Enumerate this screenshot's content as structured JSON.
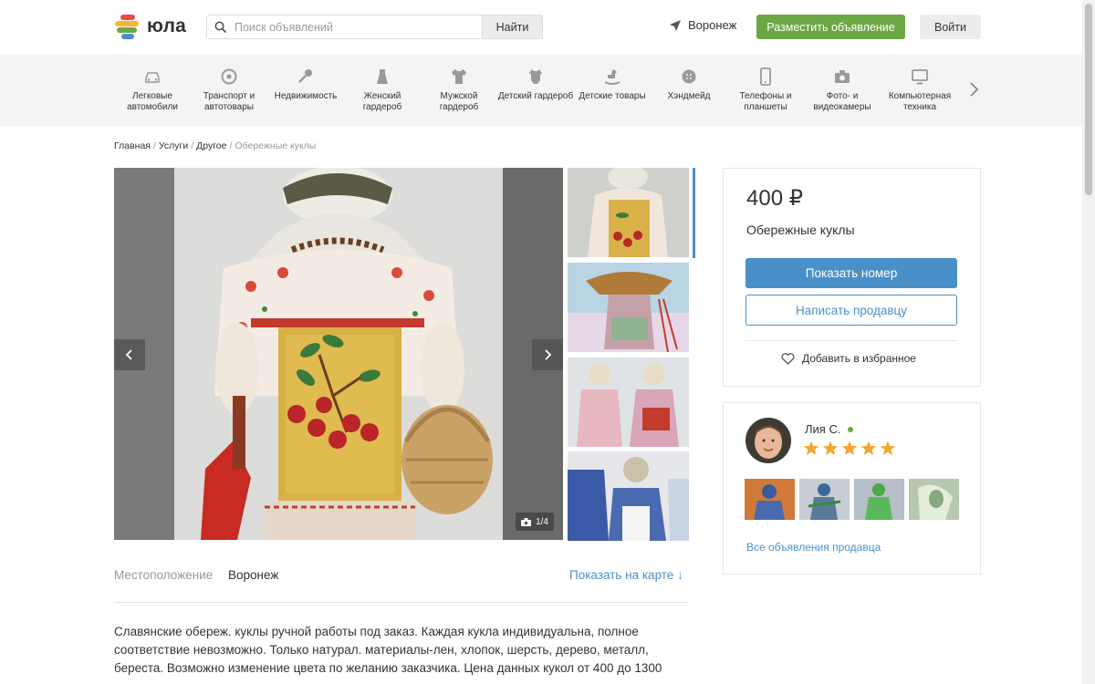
{
  "header": {
    "logo_text": "юла",
    "search_placeholder": "Поиск объявлений",
    "search_button": "Найти",
    "city": "Воронеж",
    "post_button": "Разместить объявление",
    "login_button": "Войти"
  },
  "categories": [
    {
      "label": "Легковые автомобили",
      "icon": "car-icon"
    },
    {
      "label": "Транспорт и автотовары",
      "icon": "wheel-icon"
    },
    {
      "label": "Недвижимость",
      "icon": "key-icon"
    },
    {
      "label": "Женский гардероб",
      "icon": "dress-icon"
    },
    {
      "label": "Мужской гардероб",
      "icon": "shirt-icon"
    },
    {
      "label": "Детский гардероб",
      "icon": "bodysuit-icon"
    },
    {
      "label": "Детские товары",
      "icon": "rocking-horse-icon"
    },
    {
      "label": "Хэндмейд",
      "icon": "button-icon"
    },
    {
      "label": "Телефоны и планшеты",
      "icon": "phone-icon"
    },
    {
      "label": "Фото- и видеокамеры",
      "icon": "camera-icon"
    },
    {
      "label": "Компьютерная техника",
      "icon": "monitor-icon"
    }
  ],
  "breadcrumb": {
    "items": [
      "Главная",
      "Услуги",
      "Другое"
    ],
    "current": "Обережные куклы"
  },
  "gallery": {
    "counter": "1/4"
  },
  "location": {
    "label": "Местоположение",
    "value": "Воронеж",
    "map_link": "Показать на карте ↓"
  },
  "description": "Славянские обереж. куклы ручной работы под заказ. Каждая кукла индивидуальна, полное соответствие невозможно. Только натурал. материалы-лен, хлопок, шерсть, дерево, металл, береста. Возможно изменение цвета по желанию заказчика. Цена данных кукол от 400 до 1300",
  "listing": {
    "price": "400 ₽",
    "title": "Обережные куклы",
    "show_phone": "Показать номер",
    "write_seller": "Написать продавцу",
    "add_favorite": "Добавить в избранное"
  },
  "seller": {
    "name": "Лия С.",
    "online": true,
    "rating": 5,
    "rating_max": 5,
    "all_ads_link": "Все объявления продавца"
  },
  "colors": {
    "accent_blue": "#4a90c8",
    "accent_green": "#6ca745",
    "star": "#f0a830"
  }
}
